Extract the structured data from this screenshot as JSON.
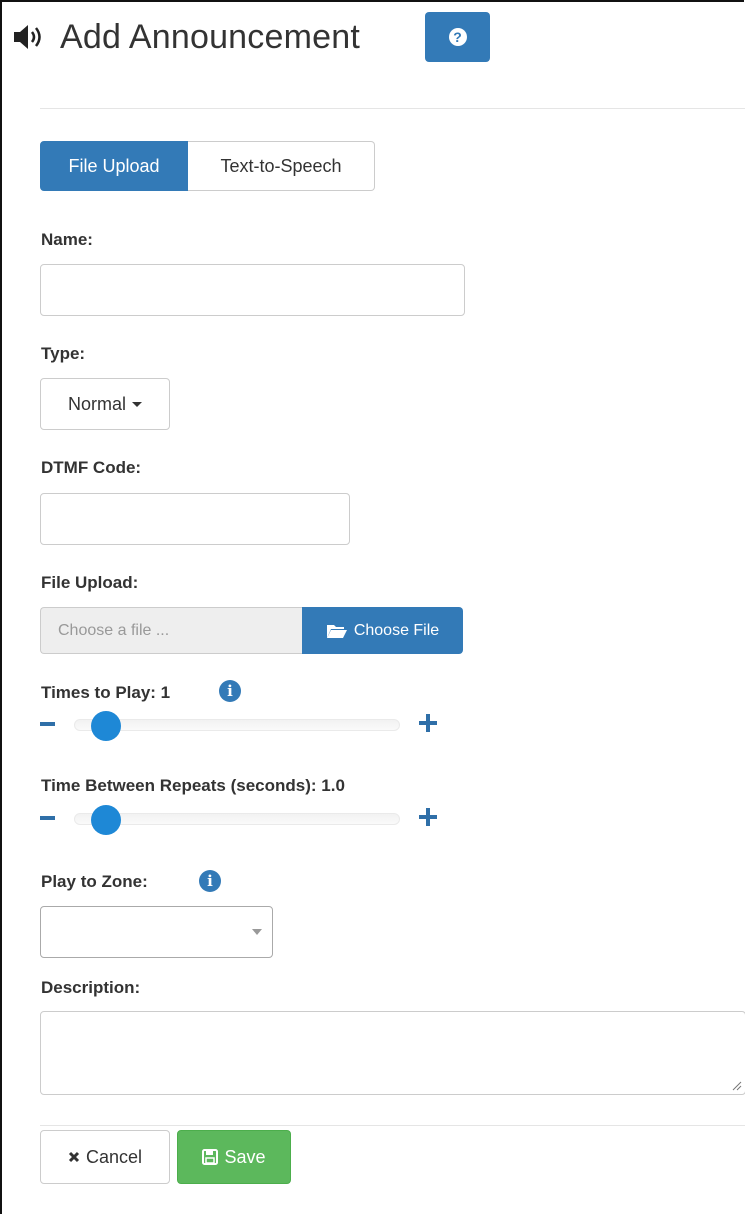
{
  "header": {
    "title": "Add Announcement",
    "help_icon": "question-circle-icon",
    "speaker_icon": "volume-icon"
  },
  "tabs": [
    {
      "label": "File Upload",
      "active": true
    },
    {
      "label": "Text-to-Speech",
      "active": false
    }
  ],
  "form": {
    "name": {
      "label": "Name:",
      "value": "",
      "placeholder": ""
    },
    "type": {
      "label": "Type:",
      "selected": "Normal"
    },
    "dtmf": {
      "label": "DTMF Code:",
      "value": "",
      "placeholder": ""
    },
    "file_upload": {
      "label": "File Upload:",
      "placeholder": "Choose a file ...",
      "button": "Choose File"
    },
    "times_to_play": {
      "label": "Times to Play: 1",
      "value": 1
    },
    "time_between": {
      "label": "Time Between Repeats (seconds): 1.0",
      "value": 1.0
    },
    "play_to_zone": {
      "label": "Play to Zone:",
      "selected": ""
    },
    "description": {
      "label": "Description:",
      "value": ""
    }
  },
  "footer": {
    "cancel_label": "Cancel",
    "save_label": "Save"
  },
  "colors": {
    "primary": "#337ab7",
    "success": "#5cb85c",
    "slider_knob": "#1e88d6"
  }
}
